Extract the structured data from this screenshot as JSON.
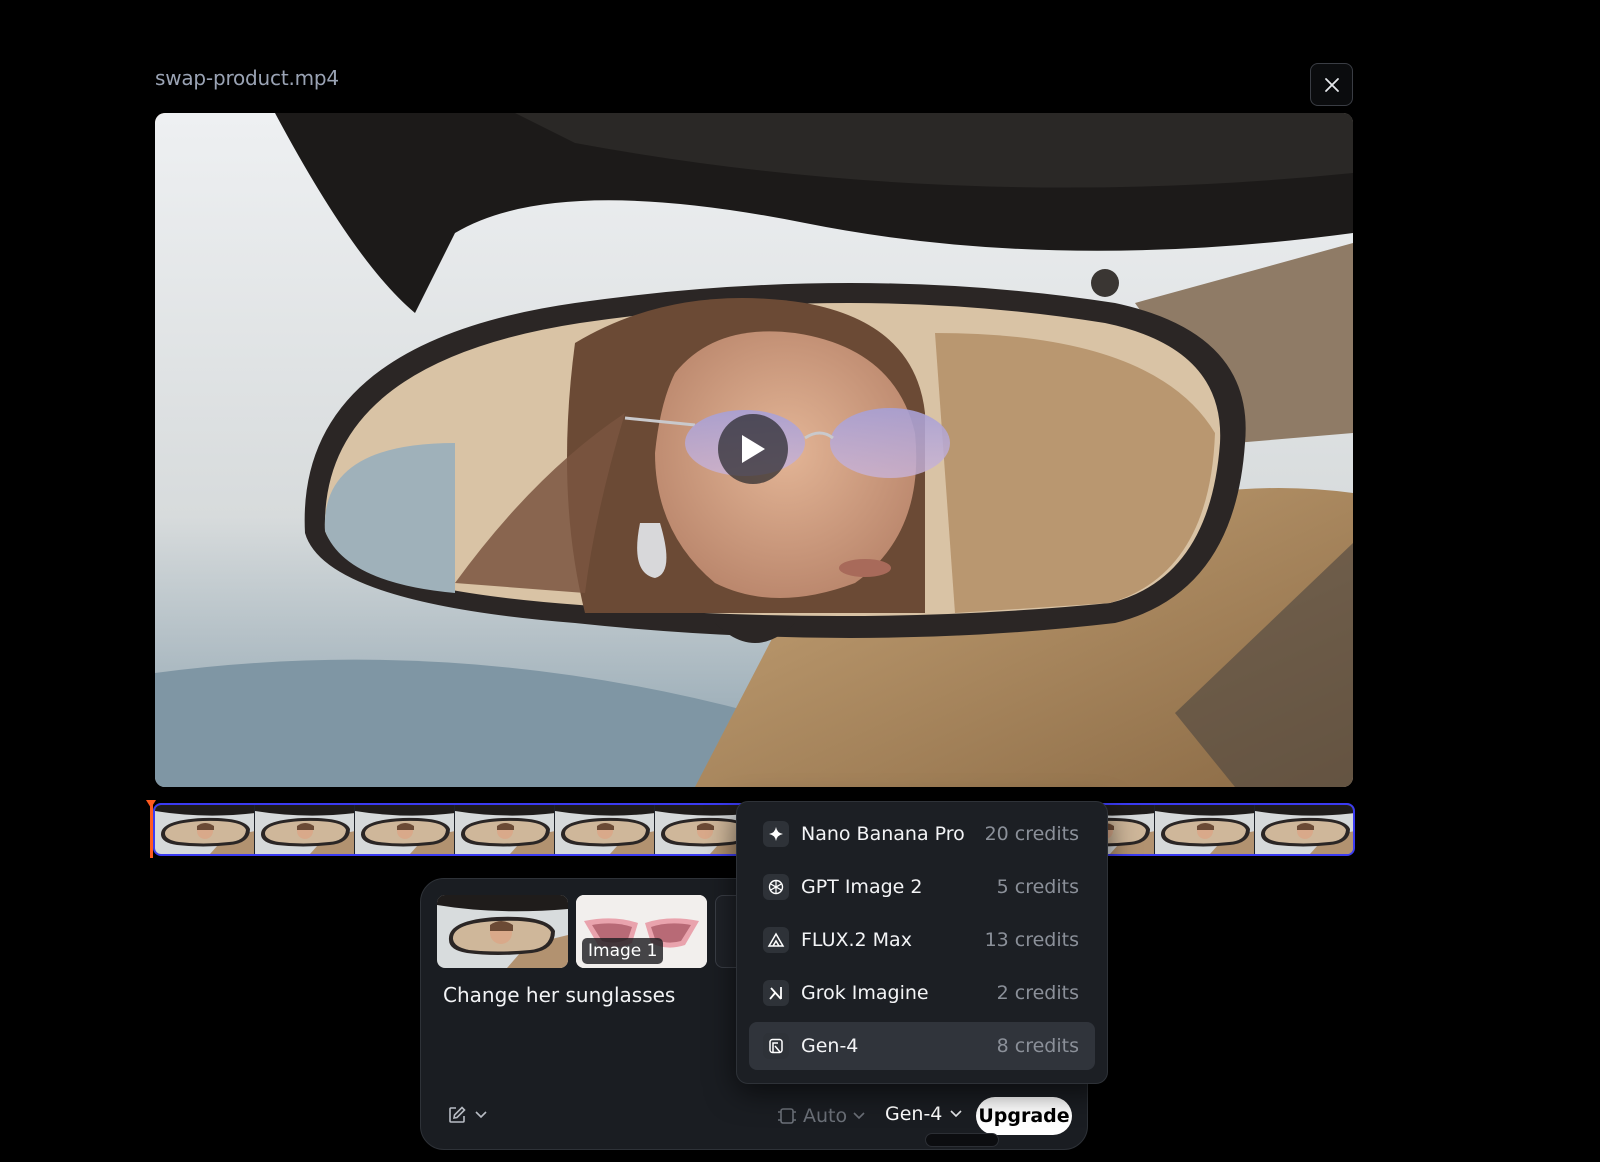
{
  "header": {
    "filename": "swap-product.mp4"
  },
  "composer": {
    "image_label": "Image 1",
    "prompt": "Change her sunglasses",
    "aspect": "Auto",
    "model": "Gen-4",
    "upgrade_label": "Upgrade"
  },
  "model_menu": [
    {
      "name": "Nano Banana Pro",
      "credits": "20 credits",
      "icon": "sparkle-icon"
    },
    {
      "name": "GPT Image 2",
      "credits": "5 credits",
      "icon": "openai-icon"
    },
    {
      "name": "FLUX.2 Max",
      "credits": "13 credits",
      "icon": "flux-icon"
    },
    {
      "name": "Grok Imagine",
      "credits": "2 credits",
      "icon": "grok-icon"
    },
    {
      "name": "Gen-4",
      "credits": "8 credits",
      "icon": "runway-icon",
      "selected": true
    }
  ],
  "colors": {
    "accent": "#3b3bf2",
    "playhead": "#ff5a1f"
  }
}
